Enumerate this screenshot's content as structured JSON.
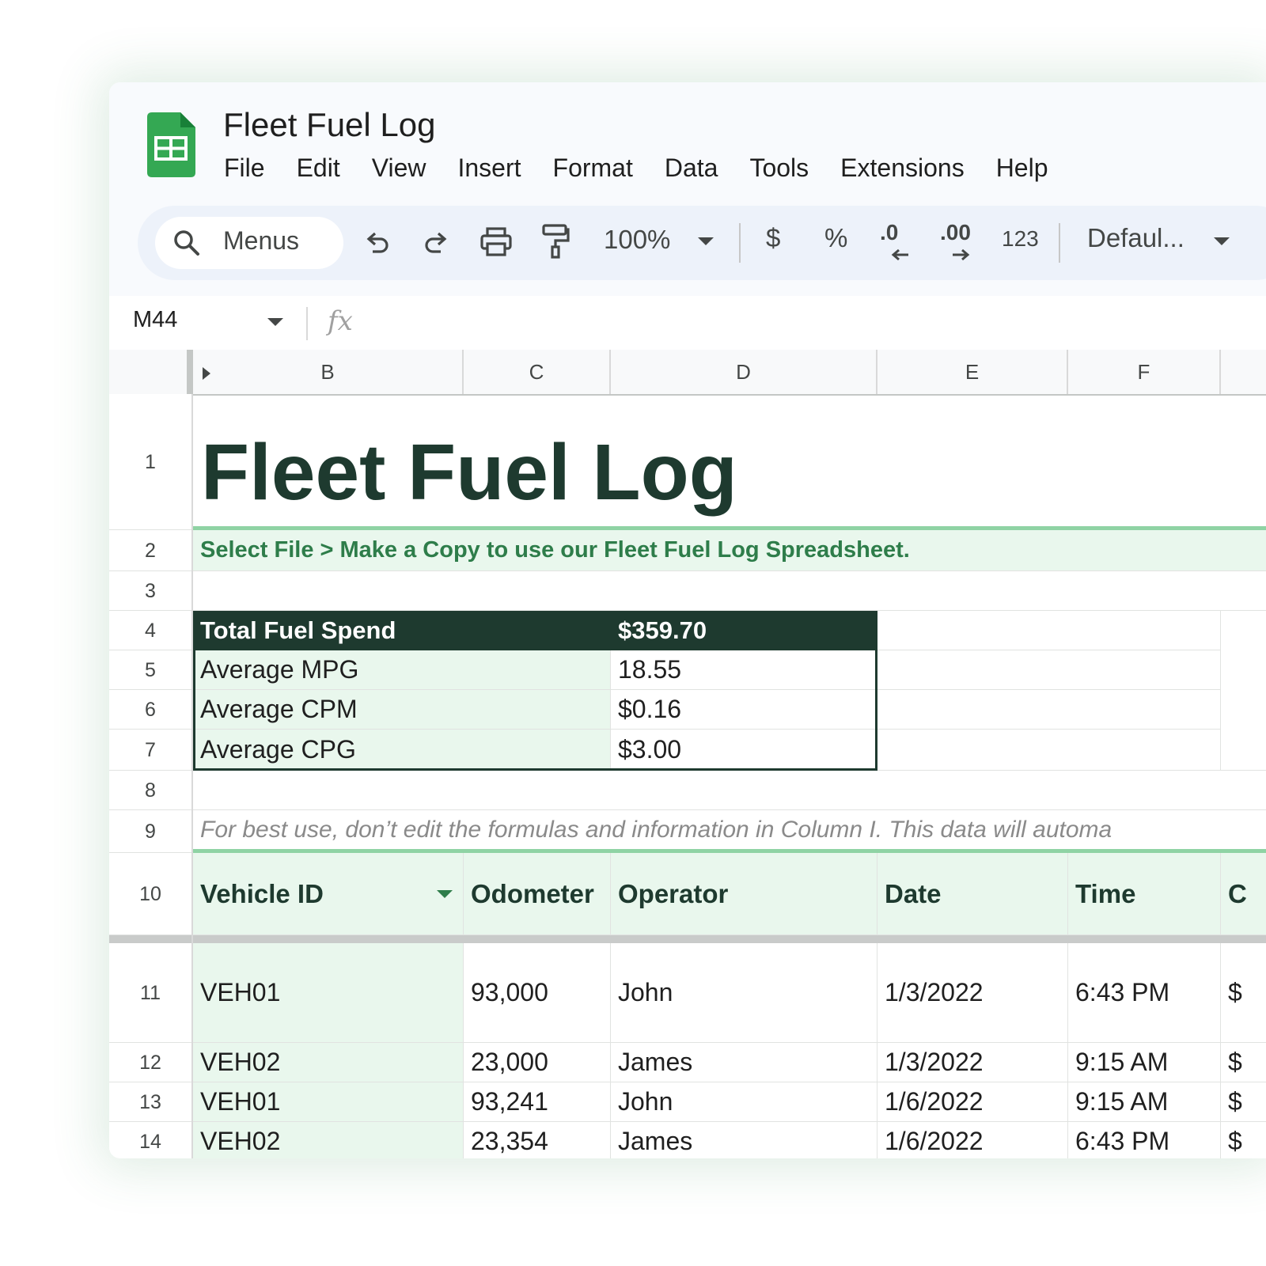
{
  "app": {
    "document_title": "Fleet Fuel Log",
    "accent_color": "#1e3a2f",
    "brand_green": "#34a853"
  },
  "menu": [
    "File",
    "Edit",
    "View",
    "Insert",
    "Format",
    "Data",
    "Tools",
    "Extensions",
    "Help"
  ],
  "toolbar": {
    "search_label": "Menus",
    "zoom": "100%",
    "currency": "$",
    "percent": "%",
    "decrease_decimal": ".0",
    "increase_decimal": ".00",
    "number_format": "123",
    "font": "Defaul..."
  },
  "formula_bar": {
    "cell_ref": "M44",
    "fx": "fx"
  },
  "columns": [
    "B",
    "C",
    "D",
    "E",
    "F"
  ],
  "rows": [
    "1",
    "2",
    "3",
    "4",
    "5",
    "6",
    "7",
    "8",
    "9",
    "10",
    "11",
    "12",
    "13",
    "14"
  ],
  "sheet": {
    "title": "Fleet Fuel Log",
    "instructions": "Select File > Make a Copy to use our Fleet Fuel Log Spreadsheet.",
    "summary": [
      {
        "label": "Total Fuel Spend",
        "value": "$359.70"
      },
      {
        "label": "Average MPG",
        "value": "18.55"
      },
      {
        "label": "Average CPM",
        "value": "$0.16"
      },
      {
        "label": "Average CPG",
        "value": "$3.00"
      }
    ],
    "note": "For best use, don’t edit the formulas and information in Column I. This data will automa",
    "headers": [
      "Vehicle ID",
      "Odometer",
      "Operator",
      "Date",
      "Time",
      "C"
    ],
    "data_rows": [
      [
        "VEH01",
        "93,000",
        "John",
        "1/3/2022",
        "6:43 PM",
        "$"
      ],
      [
        "VEH02",
        "23,000",
        "James",
        "1/3/2022",
        "9:15 AM",
        "$"
      ],
      [
        "VEH01",
        "93,241",
        "John",
        "1/6/2022",
        "9:15 AM",
        "$"
      ],
      [
        "VEH02",
        "23,354",
        "James",
        "1/6/2022",
        "6:43 PM",
        "$"
      ]
    ]
  }
}
